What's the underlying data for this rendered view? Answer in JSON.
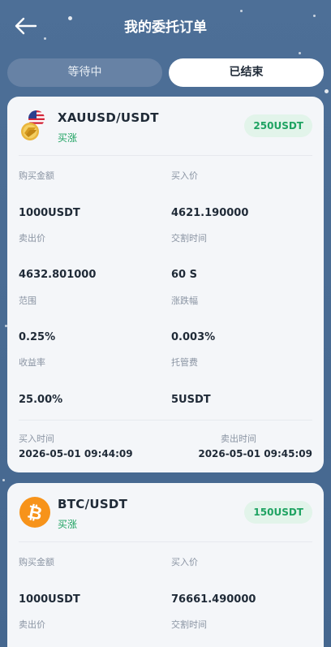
{
  "header": {
    "title": "我的委托订单",
    "back_icon": "arrow-left-icon"
  },
  "tabs": [
    {
      "label": "等待中",
      "active": false
    },
    {
      "label": "已结束",
      "active": true
    }
  ],
  "colors": {
    "background": "#4a6b91",
    "card": "#f4f6f9",
    "accent_green": "#1fa362",
    "badge_bg": "#e2f4ea",
    "text_dark": "#1f2a37",
    "text_label": "#8a94a3"
  },
  "orders": [
    {
      "pair": "XAUUSD/USDT",
      "icon": "usd-gold-icon",
      "direction": "买涨",
      "badge": "250USDT",
      "fields": [
        {
          "label": "购买金额",
          "value": "1000USDT"
        },
        {
          "label": "买入价",
          "value": "4621.190000"
        },
        {
          "label": "卖出价",
          "value": "4632.801000"
        },
        {
          "label": "交割时间",
          "value": "60 S"
        },
        {
          "label": "范围",
          "value": "0.25%"
        },
        {
          "label": "涨跌幅",
          "value": "0.003%"
        },
        {
          "label": "收益率",
          "value": "25.00%"
        },
        {
          "label": "托管费",
          "value": "5USDT"
        }
      ],
      "buy_time_label": "买入时间",
      "buy_time": "2026-05-01 09:44:09",
      "sell_time_label": "卖出时间",
      "sell_time": "2026-05-01 09:45:09"
    },
    {
      "pair": "BTC/USDT",
      "icon": "bitcoin-icon",
      "direction": "买涨",
      "badge": "150USDT",
      "fields": [
        {
          "label": "购买金额",
          "value": "1000USDT"
        },
        {
          "label": "买入价",
          "value": "76661.490000"
        },
        {
          "label": "卖出价",
          "value": ""
        },
        {
          "label": "交割时间",
          "value": ""
        }
      ]
    }
  ]
}
